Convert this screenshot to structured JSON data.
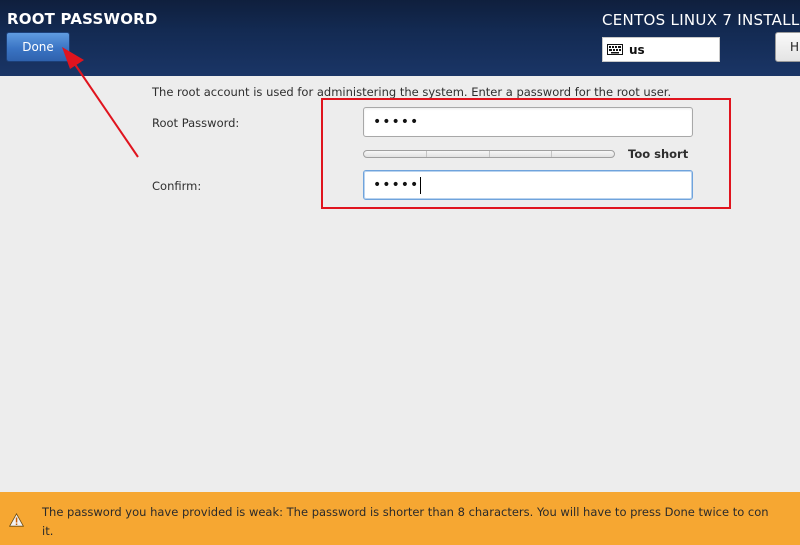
{
  "header": {
    "page_title": "ROOT PASSWORD",
    "done_label": "Done",
    "product_title": "CENTOS LINUX 7 INSTALLA",
    "keyboard_layout": "us",
    "keyboard_icon": "keyboard-icon",
    "help_label": "H"
  },
  "content": {
    "intro": "The root account is used for administering the system.  Enter a password for the root user.",
    "root_password_label": "Root Password:",
    "root_password_value": "•••••",
    "confirm_label": "Confirm:",
    "confirm_value": "•••••",
    "strength_label": "Too short",
    "strength_level": 0
  },
  "warning": {
    "icon": "warning-icon",
    "text": "The password you have provided is weak: The password is shorter than 8 characters. You will have to press Done twice to con",
    "text_continued": "it."
  },
  "colors": {
    "header_bg": "#132a52",
    "done_button": "#3a74c4",
    "warning_bg": "#f6a732",
    "annotation_red": "#e0141e"
  }
}
